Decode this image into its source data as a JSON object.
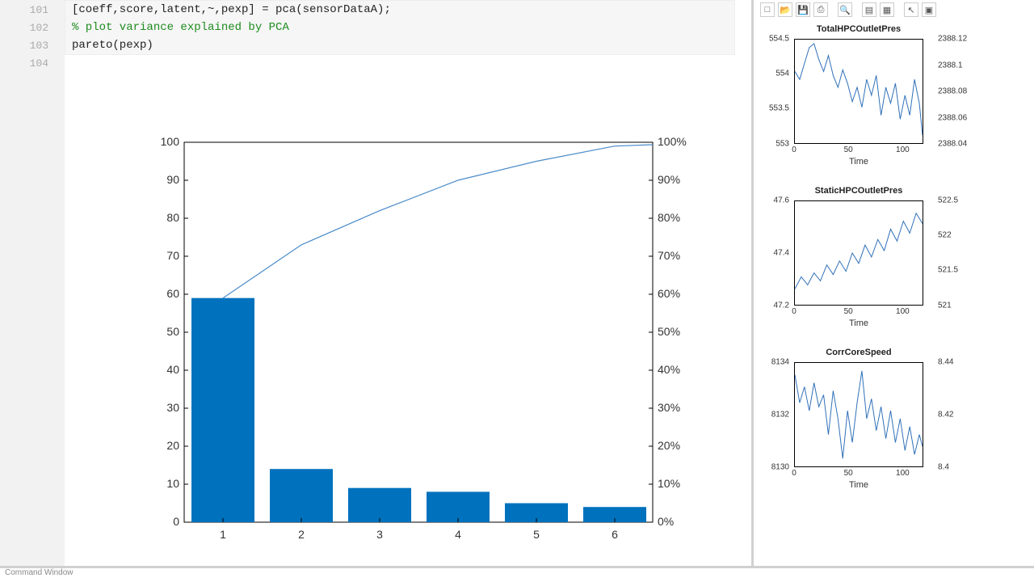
{
  "editor": {
    "line_numbers": [
      "101",
      "102",
      "103",
      "104"
    ],
    "lines": {
      "l101": "[coeff,score,latent,~,pexp] = pca(sensorDataA);",
      "l102": "",
      "l103": "% plot variance explained by PCA",
      "l104": "pareto(pexp)"
    }
  },
  "chart_data": {
    "type": "bar",
    "categories": [
      "1",
      "2",
      "3",
      "4",
      "5",
      "6"
    ],
    "values": [
      59,
      14,
      9,
      8,
      5,
      4
    ],
    "cumulative": [
      59,
      73,
      82,
      90,
      95,
      99
    ],
    "ylim_left": [
      0,
      100
    ],
    "ylim_right_pct": [
      0,
      100
    ],
    "left_ticks": [
      "0",
      "10",
      "20",
      "30",
      "40",
      "50",
      "60",
      "70",
      "80",
      "90",
      "100"
    ],
    "right_ticks": [
      "0%",
      "10%",
      "20%",
      "30%",
      "40%",
      "50%",
      "60%",
      "70%",
      "80%",
      "90%",
      "100%"
    ]
  },
  "figure_window": {
    "toolbar_icons": [
      "new-figure-icon",
      "open-icon",
      "save-icon",
      "print-icon",
      "zoom-icon",
      "data-cursor-icon",
      "rotate-icon",
      "pointer-icon",
      "legend-icon"
    ],
    "mini_plots": [
      {
        "title": "TotalHPCOutletPres",
        "xlabel": "Time",
        "x_ticks": [
          "0",
          "50",
          "100"
        ],
        "y_ticks": [
          "553",
          "553.5",
          "554",
          "554.5"
        ],
        "right_y_ticks": [
          "2388.04",
          "2388.06",
          "2388.08",
          "2388.1",
          "2388.12"
        ]
      },
      {
        "title": "StaticHPCOutletPres",
        "xlabel": "Time",
        "x_ticks": [
          "0",
          "50",
          "100"
        ],
        "y_ticks": [
          "47.2",
          "47.4",
          "47.6"
        ],
        "right_y_ticks": [
          "521",
          "521.5",
          "522",
          "522.5"
        ]
      },
      {
        "title": "CorrCoreSpeed",
        "xlabel": "Time",
        "x_ticks": [
          "0",
          "50",
          "100"
        ],
        "y_ticks": [
          "8130",
          "8132",
          "8134"
        ],
        "right_y_ticks": [
          "8.4",
          "8.42",
          "8.44"
        ]
      }
    ]
  },
  "bottom": {
    "label": "Command Window"
  }
}
